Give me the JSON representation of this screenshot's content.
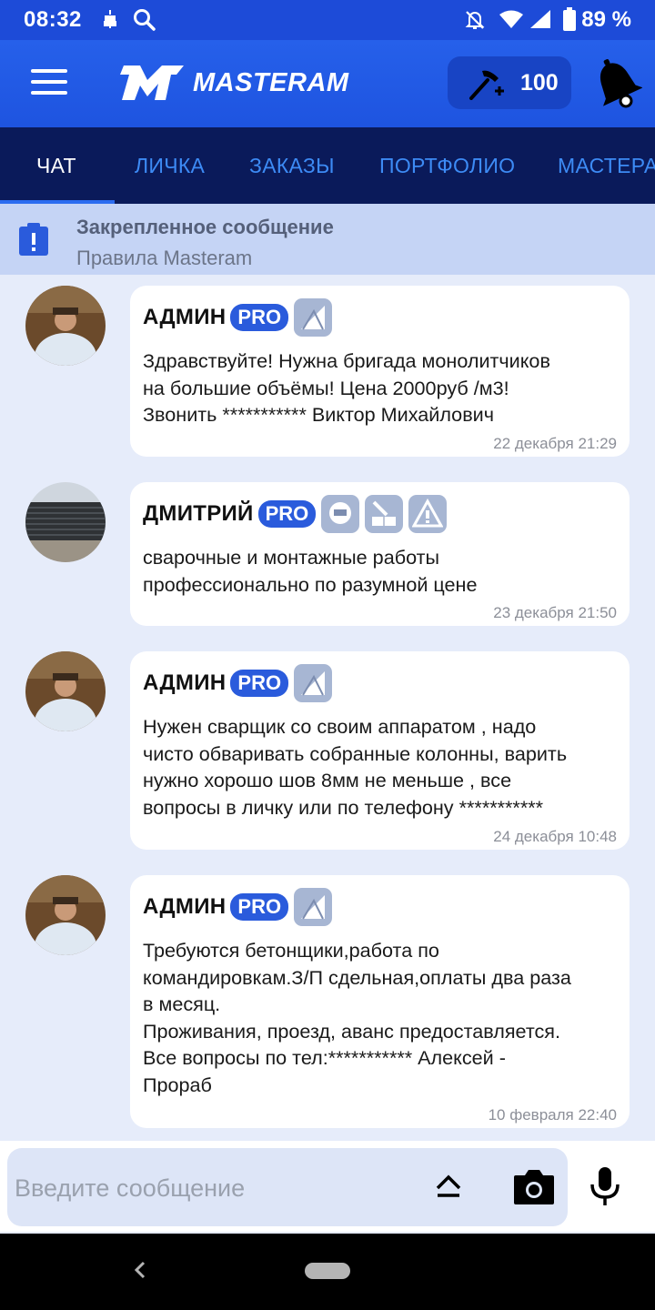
{
  "status_bar": {
    "time": "08:32",
    "battery": "89 %",
    "icons": [
      "usb-debug-icon",
      "search-icon",
      "mute-icon",
      "wifi-icon",
      "signal-icon",
      "battery-icon"
    ]
  },
  "app_bar": {
    "logo_text": "MASTERAM",
    "points_value": "100",
    "colors": {
      "primary": "#1e54e0",
      "tabs_bg": "#0a1a5a",
      "tab_text": "#3d8bf5",
      "pro_badge": "#2a5bdc"
    }
  },
  "tabs": [
    {
      "label": "ЧАТ",
      "active": true
    },
    {
      "label": "ЛИЧКА",
      "active": false
    },
    {
      "label": "ЗАКАЗЫ",
      "active": false
    },
    {
      "label": "ПОРТФОЛИО",
      "active": false
    },
    {
      "label": "МАСТЕРА",
      "active": false
    }
  ],
  "pinned": {
    "title": "Закрепленное сообщение",
    "text": "Правила Masteram"
  },
  "messages": [
    {
      "author": "АДМИН",
      "pro_label": "PRO",
      "text": "Здравствуйте! Нужна бригада монолитчиков\nна большие объёмы! Цена 2000руб /м3!\nЗвонить *********** Виктор Михайлович",
      "time": "22 декабря 21:29",
      "badges": [
        "trowel-badge"
      ]
    },
    {
      "author": "ДМИТРИЙ",
      "pro_label": "PRO",
      "text": "сварочные и монтажные работы\nпрофессионально по разумной цене",
      "time": "23 декабря 21:50",
      "badges": [
        "welder-badge",
        "bricklaying-badge",
        "warning-badge"
      ]
    },
    {
      "author": "АДМИН",
      "pro_label": "PRO",
      "text": "Нужен сварщик со своим аппаратом , надо\nчисто обваривать собранные колонны, варить\nнужно хорошо шов 8мм не меньше , все\nвопросы в личку или по телефону ***********",
      "time": "24 декабря 10:48",
      "badges": [
        "trowel-badge"
      ]
    },
    {
      "author": "АДМИН",
      "pro_label": "PRO",
      "text": "Требуются бетонщики,работа по\nкомандировкам.З/П сдельная,оплаты два раза\nв месяц.\nПроживания, проезд, аванс предоставляется.\nВсе вопросы по тел:*********** Алексей -\nПрораб",
      "time": "10 февраля 22:40",
      "badges": [
        "trowel-badge"
      ]
    }
  ],
  "input": {
    "placeholder": "Введите сообщение"
  }
}
